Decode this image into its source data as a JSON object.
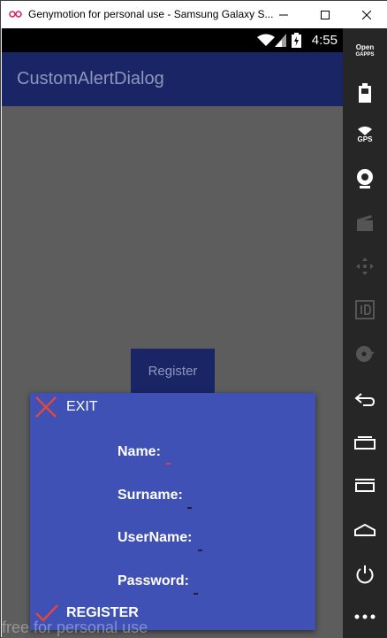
{
  "window": {
    "title": "Genymotion for personal use - Samsung Galaxy S...",
    "minimize_label": "—",
    "maximize_label": "☐",
    "close_label": "✕"
  },
  "statusbar": {
    "time": "4:55"
  },
  "app": {
    "title": "CustomAlertDialog",
    "background_button_label": "Register"
  },
  "dialog": {
    "exit_label": "EXIT",
    "fields": [
      {
        "label": "Name:",
        "value": ""
      },
      {
        "label": "Surname:",
        "value": ""
      },
      {
        "label": "UserName:",
        "value": ""
      },
      {
        "label": "Password:",
        "value": ""
      }
    ],
    "register_label": "REGISTER"
  },
  "watermark": "free for personal use",
  "sidebar": {
    "opengapps_line1": "Open",
    "opengapps_line2": "GAPPS",
    "gps_label": "GPS"
  },
  "colors": {
    "appbar": "#1a2566",
    "dialog": "#3f51b5",
    "accent": "#e53955",
    "sidebar": "#262626"
  }
}
